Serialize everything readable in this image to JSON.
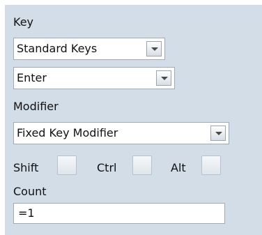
{
  "key_section": {
    "label": "Key",
    "key_type_select": {
      "value": "Standard Keys"
    },
    "key_select": {
      "value": "Enter"
    }
  },
  "modifier_section": {
    "label": "Modifier",
    "modifier_select": {
      "value": "Fixed Key Modifier"
    },
    "checkboxes": [
      {
        "label": "Shift"
      },
      {
        "label": "Ctrl"
      },
      {
        "label": "Alt"
      }
    ]
  },
  "count_section": {
    "label": "Count",
    "input_value": "=1"
  }
}
